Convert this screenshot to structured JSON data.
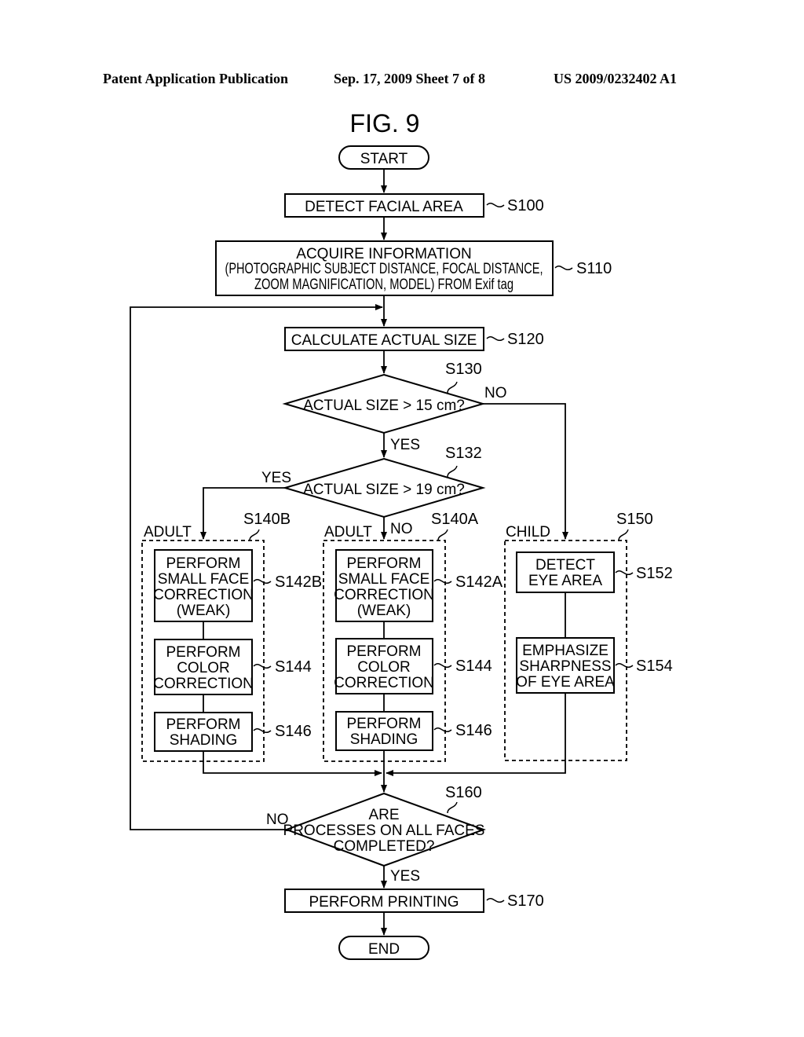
{
  "header": {
    "publication": "Patent Application Publication",
    "date_sheet": "Sep. 17, 2009   Sheet 7 of 8",
    "patent_number": "US 2009/0232402 A1"
  },
  "figure": {
    "title": "FIG. 9"
  },
  "terminals": {
    "start": "START",
    "end": "END"
  },
  "steps": {
    "s100": {
      "ref": "S100",
      "lines": [
        "DETECT FACIAL AREA"
      ]
    },
    "s110": {
      "ref": "S110",
      "lines": [
        "ACQUIRE INFORMATION",
        "(PHOTOGRAPHIC SUBJECT DISTANCE, FOCAL DISTANCE,",
        "ZOOM MAGNIFICATION, MODEL) FROM Exif tag"
      ]
    },
    "s120": {
      "ref": "S120",
      "lines": [
        "CALCULATE ACTUAL SIZE"
      ]
    },
    "s130": {
      "ref": "S130",
      "lines": [
        "ACTUAL SIZE > 15 cm?"
      ],
      "yes": "YES",
      "no": "NO"
    },
    "s132": {
      "ref": "S132",
      "lines": [
        "ACTUAL SIZE > 19 cm?"
      ],
      "yes": "YES",
      "no": "NO"
    },
    "s140b": {
      "ref": "S140B",
      "group": "ADULT"
    },
    "s142b": {
      "ref": "S142B",
      "lines": [
        "PERFORM",
        "SMALL FACE",
        "CORRECTION",
        "(WEAK)"
      ]
    },
    "s144b": {
      "ref": "S144",
      "lines": [
        "PERFORM",
        "COLOR",
        "CORRECTION"
      ]
    },
    "s146b": {
      "ref": "S146",
      "lines": [
        "PERFORM",
        "SHADING"
      ]
    },
    "s140a": {
      "ref": "S140A",
      "group": "ADULT"
    },
    "s142a": {
      "ref": "S142A",
      "lines": [
        "PERFORM",
        "SMALL FACE",
        "CORRECTION",
        "(WEAK)"
      ]
    },
    "s144a": {
      "ref": "S144",
      "lines": [
        "PERFORM",
        "COLOR",
        "CORRECTION"
      ]
    },
    "s146a": {
      "ref": "S146",
      "lines": [
        "PERFORM",
        "SHADING"
      ]
    },
    "s150": {
      "ref": "S150",
      "group": "CHILD"
    },
    "s152": {
      "ref": "S152",
      "lines": [
        "DETECT",
        "EYE AREA"
      ]
    },
    "s154": {
      "ref": "S154",
      "lines": [
        "EMPHASIZE",
        "SHARPNESS",
        "OF EYE AREA"
      ]
    },
    "s160": {
      "ref": "S160",
      "lines": [
        "ARE",
        "PROCESSES ON ALL FACES",
        "COMPLETED?"
      ],
      "yes": "YES",
      "no": "NO"
    },
    "s170": {
      "ref": "S170",
      "lines": [
        "PERFORM PRINTING"
      ]
    }
  }
}
